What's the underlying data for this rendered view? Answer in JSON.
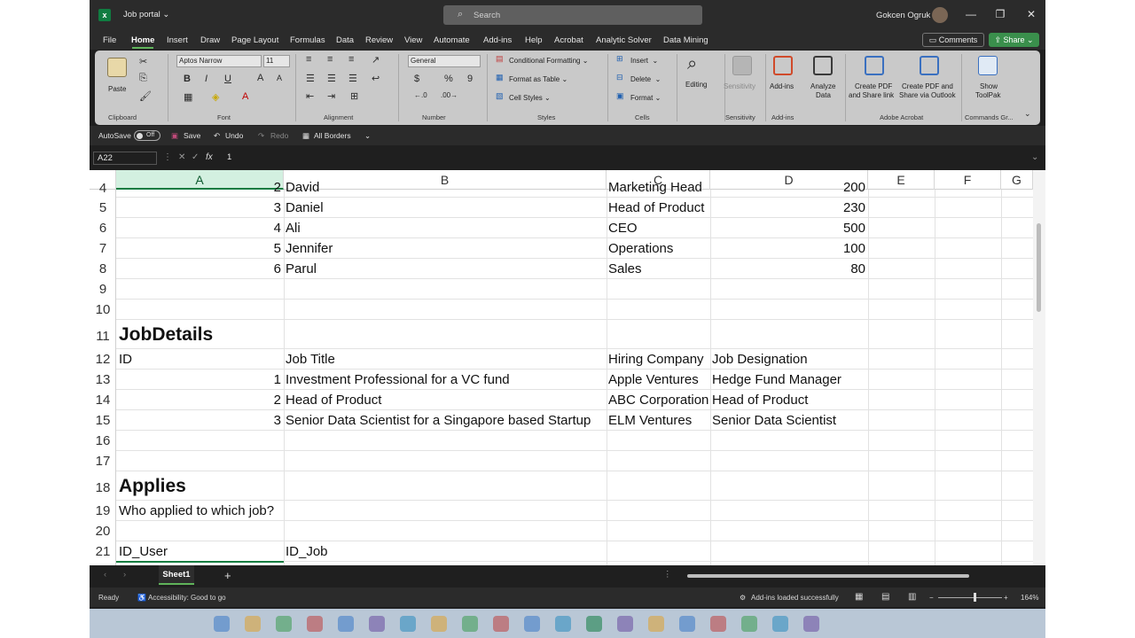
{
  "window": {
    "doc_name": "Job portal",
    "search_placeholder": "Search",
    "user_name": "Gokcen Ogruk",
    "minimize": "—",
    "restore": "❐",
    "close": "✕"
  },
  "menu": {
    "items": [
      "File",
      "Home",
      "Insert",
      "Draw",
      "Page Layout",
      "Formulas",
      "Data",
      "Review",
      "View",
      "Automate",
      "Add-ins",
      "Help",
      "Acrobat",
      "Analytic Solver",
      "Data Mining"
    ],
    "active": "Home",
    "comments": "Comments",
    "share": "Share"
  },
  "ribbon": {
    "clipboard": {
      "paste": "Paste",
      "label": "Clipboard"
    },
    "font": {
      "name": "Aptos Narrow",
      "size": "11",
      "label": "Font"
    },
    "alignment": {
      "label": "Alignment"
    },
    "number": {
      "format": "General",
      "label": "Number"
    },
    "styles": {
      "conditional": "Conditional Formatting",
      "format_table": "Format as Table",
      "cell_styles": "Cell Styles",
      "label": "Styles"
    },
    "cells": {
      "insert": "Insert",
      "delete": "Delete",
      "format": "Format",
      "label": "Cells"
    },
    "editing": {
      "label": "Editing"
    },
    "sensitivity": {
      "button": "Sensitivity",
      "label": "Sensitivity"
    },
    "addins": {
      "button": "Add-ins",
      "label": "Add-ins"
    },
    "analyze": {
      "line1": "Analyze",
      "line2": "Data"
    },
    "acrobat": {
      "pdf1_line1": "Create PDF",
      "pdf1_line2": "and Share link",
      "pdf2_line1": "Create PDF and",
      "pdf2_line2": "Share via Outlook",
      "label": "Adobe Acrobat"
    },
    "commands": {
      "line1": "Show",
      "line2": "ToolPak",
      "label": "Commands Gr..."
    }
  },
  "qat": {
    "autosave": "AutoSave",
    "toggle": "Off",
    "save": "Save",
    "undo": "Undo",
    "redo": "Redo",
    "borders": "All Borders"
  },
  "formula_bar": {
    "cell_ref": "A22",
    "fx": "fx",
    "value": "1"
  },
  "columns": [
    "A",
    "B",
    "C",
    "D",
    "E",
    "F",
    "G"
  ],
  "rows": [
    {
      "num": "4",
      "a": "2",
      "b": "David",
      "c": "Marketing Head",
      "d": "200"
    },
    {
      "num": "5",
      "a": "3",
      "b": "Daniel",
      "c": "Head of Product",
      "d": "230"
    },
    {
      "num": "6",
      "a": "4",
      "b": "Ali",
      "c": "CEO",
      "d": "500"
    },
    {
      "num": "7",
      "a": "5",
      "b": "Jennifer",
      "c": "Operations",
      "d": "100"
    },
    {
      "num": "8",
      "a": "6",
      "b": "Parul",
      "c": "Sales",
      "d": "80"
    },
    {
      "num": "9"
    },
    {
      "num": "10"
    },
    {
      "num": "11",
      "a_title": "JobDetails"
    },
    {
      "num": "12",
      "a_text": "ID",
      "b": "Job Title",
      "c": "Hiring Company",
      "d_text": "Job Designation"
    },
    {
      "num": "13",
      "a": "1",
      "b": "Investment Professional for a VC fund",
      "c": "Apple Ventures",
      "d_text": "Hedge Fund Manager"
    },
    {
      "num": "14",
      "a": "2",
      "b": "Head of Product",
      "c": "ABC Corporation",
      "d_text": "Head of Product"
    },
    {
      "num": "15",
      "a": "3",
      "b": "Senior Data Scientist for a Singapore based Startup",
      "c": "ELM Ventures",
      "d_text": "Senior Data Scientist"
    },
    {
      "num": "16"
    },
    {
      "num": "17"
    },
    {
      "num": "18",
      "a_title": "Applies"
    },
    {
      "num": "19",
      "a_text": "Who applied to which job?"
    },
    {
      "num": "20"
    },
    {
      "num": "21",
      "a_text": "ID_User",
      "b": "ID_Job"
    }
  ],
  "sheet_tab": "Sheet1",
  "add_sheet": "+",
  "status": {
    "ready": "Ready",
    "accessibility": "Accessibility: Good to go",
    "addins": "Add-ins loaded successfully",
    "zoom": "164%"
  }
}
